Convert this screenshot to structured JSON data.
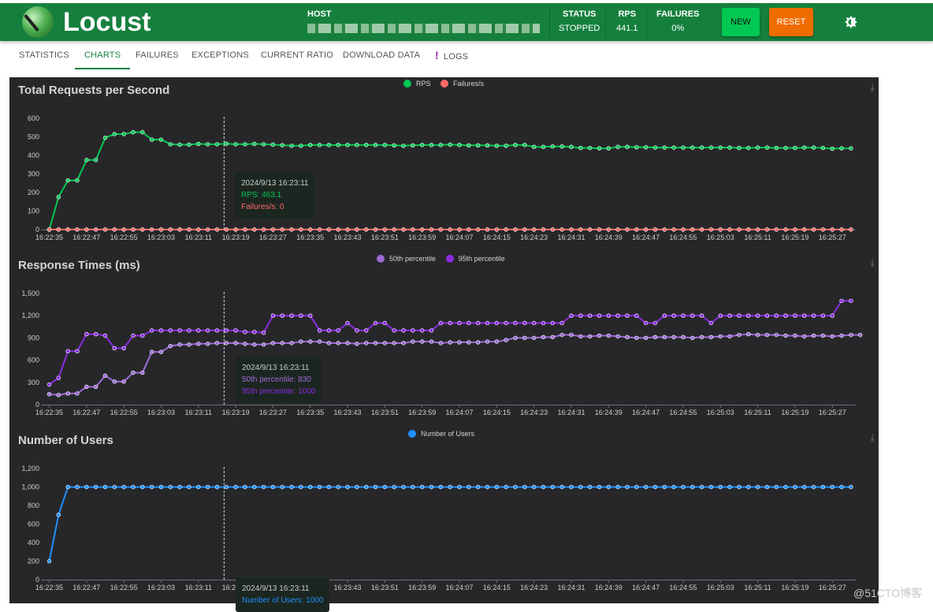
{
  "header": {
    "brand": "Locust",
    "host_label": "HOST",
    "host_value": "(redacted)",
    "status_label": "STATUS",
    "status_value": "STOPPED",
    "rps_label": "RPS",
    "rps_value": "441.1",
    "failures_label": "FAILURES",
    "failures_value": "0%",
    "new_button": "NEW",
    "reset_button": "RESET",
    "theme_icon": "brightness-icon"
  },
  "tabs": [
    {
      "label": "STATISTICS"
    },
    {
      "label": "CHARTS",
      "active": true
    },
    {
      "label": "FAILURES"
    },
    {
      "label": "EXCEPTIONS"
    },
    {
      "label": "CURRENT RATIO"
    },
    {
      "label": "DOWNLOAD DATA"
    },
    {
      "label": "LOGS",
      "icon": "!"
    }
  ],
  "watermark": "@51CTO博客",
  "chart_data": [
    {
      "type": "line",
      "title": "Total Requests per Second",
      "ylim": [
        0,
        600
      ],
      "yticks": [
        "0",
        "100",
        "200",
        "300",
        "400",
        "500",
        "600"
      ],
      "ytick_values": [
        0,
        100,
        200,
        300,
        400,
        500,
        600
      ],
      "xtick_labels": [
        "16:22:35",
        "16:22:47",
        "16:22:55",
        "16:23:03",
        "16:23:11",
        "16:23:19",
        "16:23:27",
        "16:23:35",
        "16:23:43",
        "16:23:51",
        "16:23:59",
        "16:24:07",
        "16:24:15",
        "16:24:23",
        "16:24:31",
        "16:24:39",
        "16:24:47",
        "16:24:55",
        "16:25:03",
        "16:25:11",
        "16:25:19",
        "16:25:27"
      ],
      "legend": "top-center",
      "series": [
        {
          "name": "RPS",
          "color": "#00c853",
          "values": [
            0,
            175,
            265,
            265,
            375,
            375,
            495,
            515,
            515,
            525,
            525,
            485,
            485,
            460,
            458,
            458,
            462,
            460,
            460,
            463,
            460,
            460,
            462,
            460,
            458,
            455,
            452,
            452,
            456,
            456,
            456,
            456,
            456,
            456,
            456,
            456,
            456,
            454,
            452,
            454,
            456,
            456,
            456,
            458,
            456,
            454,
            454,
            454,
            452,
            452,
            456,
            456,
            446,
            446,
            448,
            448,
            446,
            440,
            440,
            438,
            438,
            446,
            446,
            444,
            444,
            442,
            442,
            442,
            442,
            442,
            442,
            442,
            442,
            442,
            440,
            440,
            442,
            442,
            440,
            440,
            440,
            442,
            442,
            440,
            436,
            438,
            438
          ]
        },
        {
          "name": "Failures/s",
          "color": "#ff6b6b",
          "values": [
            0,
            0,
            0,
            0,
            0,
            0,
            0,
            0,
            0,
            0,
            0,
            0,
            0,
            0,
            0,
            0,
            0,
            0,
            0,
            0,
            0,
            0,
            0,
            0,
            0,
            0,
            0,
            0,
            0,
            0,
            0,
            0,
            0,
            0,
            0,
            0,
            0,
            0,
            0,
            0,
            0,
            0,
            0,
            0,
            0,
            0,
            0,
            0,
            0,
            0,
            0,
            0,
            0,
            0,
            0,
            0,
            0,
            0,
            0,
            0,
            0,
            0,
            0,
            0,
            0,
            0,
            0,
            0,
            0,
            0,
            0,
            0,
            0,
            0,
            0,
            0,
            0,
            0,
            0,
            0,
            0,
            0,
            0,
            0,
            0,
            0,
            0
          ]
        }
      ],
      "tooltip": {
        "time": "2024/9/13 16:23:11",
        "lines": [
          "RPS: 463.1",
          "Failures/s: 0"
        ]
      }
    },
    {
      "type": "line",
      "title": "Response Times (ms)",
      "ylim": [
        0,
        1500
      ],
      "yticks": [
        "0",
        "300",
        "600",
        "900",
        "1,200",
        "1,500"
      ],
      "ytick_values": [
        0,
        300,
        600,
        900,
        1200,
        1500
      ],
      "legend": "top-center",
      "series": [
        {
          "name": "50th percentile",
          "color": "#9c6ad6",
          "values": [
            140,
            130,
            150,
            150,
            240,
            240,
            390,
            310,
            310,
            430,
            430,
            710,
            710,
            790,
            810,
            810,
            820,
            820,
            830,
            830,
            830,
            820,
            810,
            810,
            830,
            830,
            830,
            850,
            850,
            850,
            830,
            830,
            830,
            820,
            830,
            830,
            830,
            830,
            830,
            850,
            850,
            850,
            830,
            840,
            840,
            840,
            840,
            850,
            850,
            870,
            900,
            900,
            900,
            910,
            910,
            940,
            940,
            920,
            920,
            930,
            930,
            920,
            910,
            900,
            900,
            910,
            910,
            910,
            910,
            900,
            910,
            910,
            920,
            920,
            940,
            950,
            940,
            940,
            940,
            930,
            930,
            920,
            930,
            930,
            920,
            930,
            940,
            940
          ]
        },
        {
          "name": "95th percentile",
          "color": "#8a2be2",
          "values": [
            270,
            360,
            720,
            720,
            950,
            950,
            930,
            760,
            760,
            930,
            930,
            1000,
            1000,
            1000,
            1000,
            1000,
            1000,
            1000,
            1000,
            1000,
            1000,
            980,
            980,
            970,
            1200,
            1200,
            1200,
            1200,
            1200,
            1000,
            1000,
            1000,
            1100,
            1000,
            1000,
            1100,
            1100,
            1000,
            1000,
            1000,
            1000,
            1000,
            1100,
            1100,
            1100,
            1100,
            1100,
            1100,
            1100,
            1100,
            1100,
            1100,
            1100,
            1100,
            1100,
            1100,
            1200,
            1200,
            1200,
            1200,
            1200,
            1200,
            1200,
            1200,
            1100,
            1100,
            1200,
            1200,
            1200,
            1200,
            1200,
            1100,
            1200,
            1200,
            1200,
            1200,
            1200,
            1200,
            1200,
            1200,
            1200,
            1200,
            1200,
            1200,
            1200,
            1400,
            1400
          ]
        }
      ],
      "tooltip": {
        "time": "2024/9/13 16:23:11",
        "lines": [
          "50th percentile: 830",
          "95th percentile: 1000"
        ]
      }
    },
    {
      "type": "line",
      "title": "Number of Users",
      "ylim": [
        0,
        1200
      ],
      "yticks": [
        "0",
        "200",
        "400",
        "600",
        "800",
        "1,000",
        "1,200"
      ],
      "ytick_values": [
        0,
        200,
        400,
        600,
        800,
        1000,
        1200
      ],
      "legend": "top-center",
      "series": [
        {
          "name": "Number of Users",
          "color": "#1e90ff",
          "values": [
            200,
            700,
            1000,
            1000,
            1000,
            1000,
            1000,
            1000,
            1000,
            1000,
            1000,
            1000,
            1000,
            1000,
            1000,
            1000,
            1000,
            1000,
            1000,
            1000,
            1000,
            1000,
            1000,
            1000,
            1000,
            1000,
            1000,
            1000,
            1000,
            1000,
            1000,
            1000,
            1000,
            1000,
            1000,
            1000,
            1000,
            1000,
            1000,
            1000,
            1000,
            1000,
            1000,
            1000,
            1000,
            1000,
            1000,
            1000,
            1000,
            1000,
            1000,
            1000,
            1000,
            1000,
            1000,
            1000,
            1000,
            1000,
            1000,
            1000,
            1000,
            1000,
            1000,
            1000,
            1000,
            1000,
            1000,
            1000,
            1000,
            1000,
            1000,
            1000,
            1000,
            1000,
            1000,
            1000,
            1000,
            1000,
            1000,
            1000,
            1000,
            1000,
            1000,
            1000,
            1000,
            1000,
            1000
          ]
        }
      ],
      "tooltip": {
        "time": "2024/9/13 16:23:11",
        "lines": [
          "Number of Users: 1000"
        ]
      }
    }
  ]
}
